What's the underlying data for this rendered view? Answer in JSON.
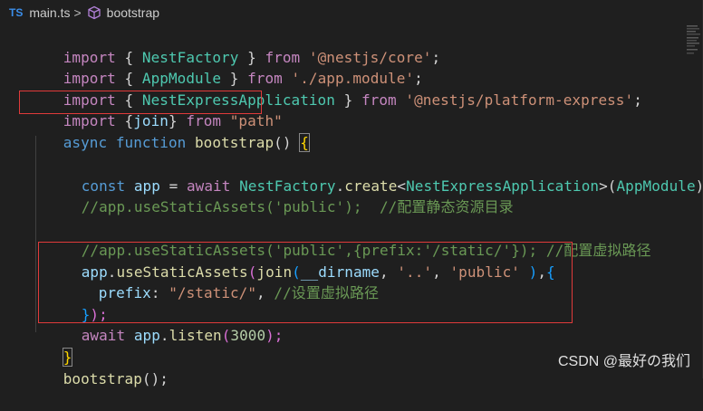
{
  "breadcrumb": {
    "ts_label": "TS",
    "file": "main.ts",
    "separator": ">",
    "symbol": "bootstrap"
  },
  "code": {
    "l1": {
      "a": "import",
      "b": " { ",
      "c": "NestFactory",
      "d": " } ",
      "e": "from",
      "f": " ",
      "g": "'@nestjs/core'",
      "h": ";"
    },
    "l2": {
      "a": "import",
      "b": " { ",
      "c": "AppModule",
      "d": " } ",
      "e": "from",
      "f": " ",
      "g": "'./app.module'",
      "h": ";"
    },
    "l3": {
      "a": "import",
      "b": " { ",
      "c": "NestExpressApplication",
      "d": " } ",
      "e": "from",
      "f": " ",
      "g": "'@nestjs/platform-express'",
      "h": ";"
    },
    "l4": {
      "a": "import",
      "b": " {",
      "c": "join",
      "d": "} ",
      "e": "from",
      "f": " ",
      "g": "\"path\""
    },
    "l5": {
      "a": "async",
      "b": " ",
      "c": "function",
      "d": " ",
      "e": "bootstrap",
      "f": "() ",
      "g": "{"
    },
    "l7": {
      "a": "const",
      "b": " ",
      "c": "app",
      "d": " = ",
      "e": "await",
      "f": " ",
      "g": "NestFactory",
      "h": ".",
      "i": "create",
      "j": "<",
      "k": "NestExpressApplication",
      "l": ">(",
      "m": "AppModule",
      "n": ");"
    },
    "l8": {
      "a": "//app.useStaticAssets('public');  //配置静态资源目录"
    },
    "l10": {
      "a": "//app.useStaticAssets('public',{prefix:'/static/'}); //配置虚拟路径"
    },
    "l11": {
      "a": "app",
      "b": ".",
      "c": "useStaticAssets",
      "d": "(",
      "e": "join",
      "f": "(",
      "g": "__dirname",
      "h": ", ",
      "i": "'..'",
      "j": ", ",
      "k": "'public'",
      "l": " )",
      "m": ",",
      "n": "{"
    },
    "l12": {
      "a": "prefix",
      "b": ": ",
      "c": "\"/static/\"",
      "d": ", ",
      "e": "//设置虚拟路径"
    },
    "l13": {
      "a": "}",
      "b": ");"
    },
    "l14": {
      "a": "await",
      "b": " ",
      "c": "app",
      "d": ".",
      "e": "listen",
      "f": "(",
      "g": "3000",
      "h": ");"
    },
    "l15": {
      "a": "}"
    },
    "l16": {
      "a": "bootstrap",
      "b": "();"
    }
  },
  "watermark": "CSDN @最好の我们",
  "colors": {
    "background": "#1f1f1f",
    "keyword": "#c586c0",
    "storage": "#569cd6",
    "function": "#dcdcaa",
    "class": "#4ec9b0",
    "variable": "#9cdcfe",
    "string": "#ce9178",
    "number": "#b5cea8",
    "comment": "#6a9955",
    "highlight_box": "#e03a3a"
  }
}
